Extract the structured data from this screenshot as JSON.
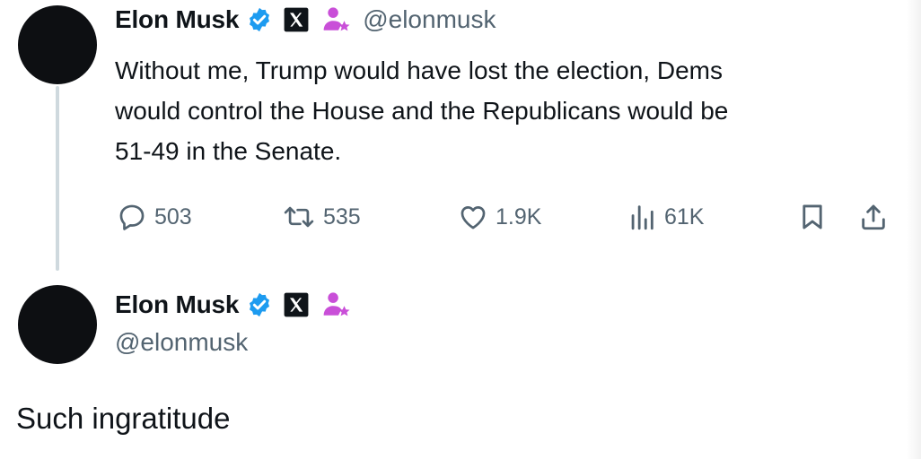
{
  "tweet": {
    "display_name": "Elon Musk",
    "handle": "@elonmusk",
    "badges": [
      "verified-check-icon",
      "x-logo-icon",
      "affiliate-person-icon"
    ],
    "text_lines": [
      "Without me, Trump would have lost the election, Dems",
      "would control the House and the Republicans would be",
      "51-49 in the Senate."
    ],
    "actions": {
      "replies": "503",
      "reposts": "535",
      "likes": "1.9K",
      "views": "61K"
    }
  },
  "reply": {
    "display_name": "Elon Musk",
    "handle": "@elonmusk",
    "badges": [
      "verified-check-icon",
      "x-logo-icon",
      "affiliate-person-icon"
    ],
    "text": "Such ingratitude"
  },
  "colors": {
    "text": "#0f1419",
    "secondary": "#536471",
    "verified": "#1d9bf0",
    "affiliate": "#c94fd8",
    "thread_line": "#cfd9de"
  }
}
